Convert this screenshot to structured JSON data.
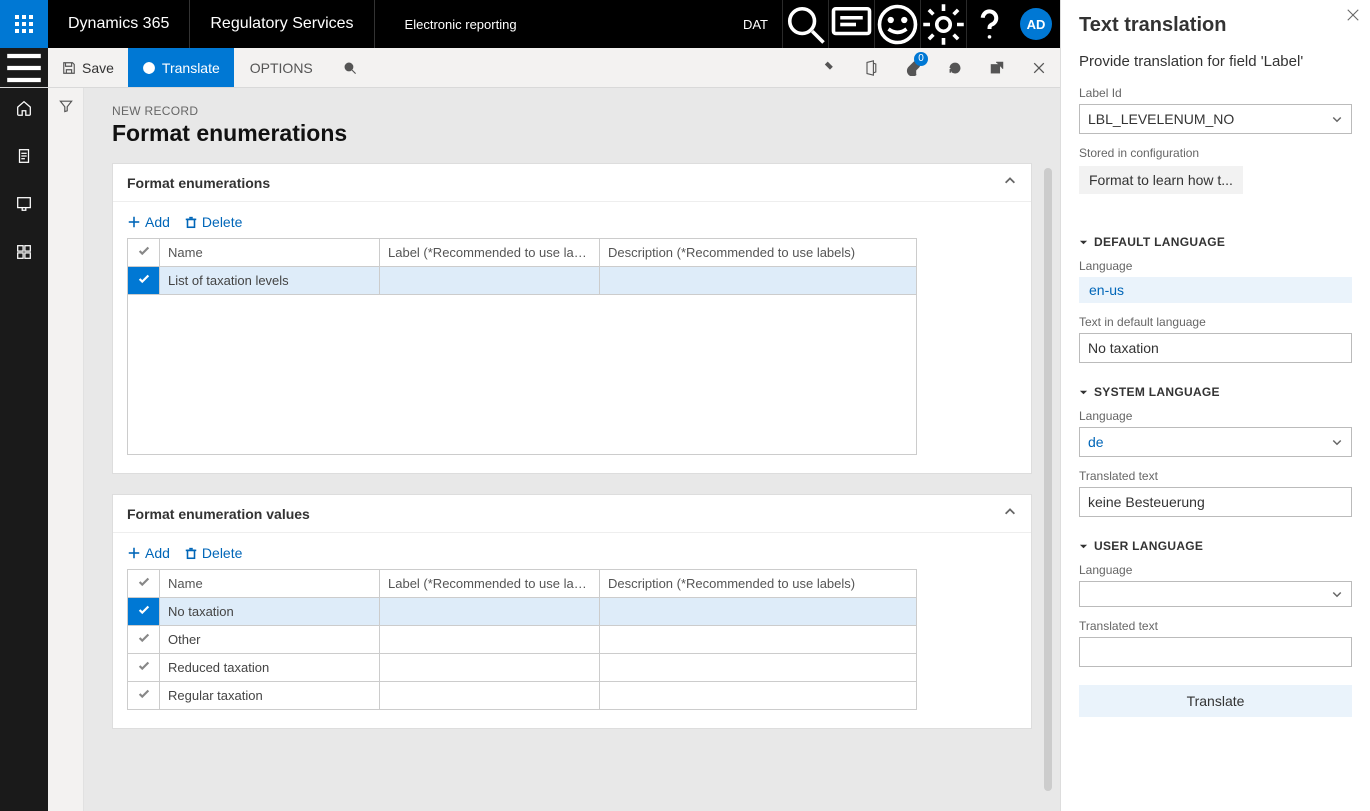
{
  "topbar": {
    "brand": "Dynamics 365",
    "service": "Regulatory Services",
    "breadcrumb": "Electronic reporting",
    "entity": "DAT",
    "avatar": "AD"
  },
  "actionbar": {
    "save": "Save",
    "translate": "Translate",
    "options": "OPTIONS",
    "badge": "0"
  },
  "page": {
    "newRecord": "NEW RECORD",
    "title": "Format enumerations"
  },
  "card1": {
    "title": "Format enumerations",
    "add": "Add",
    "delete": "Delete",
    "columns": {
      "name": "Name",
      "label": "Label (*Recommended to use labels)",
      "description": "Description (*Recommended to use labels)"
    },
    "rows": [
      {
        "name": "List of taxation levels",
        "label": "",
        "description": "",
        "selected": true
      }
    ]
  },
  "card2": {
    "title": "Format enumeration values",
    "add": "Add",
    "delete": "Delete",
    "columns": {
      "name": "Name",
      "label": "Label (*Recommended to use labels)",
      "description": "Description (*Recommended to use labels)"
    },
    "rows": [
      {
        "name": "No taxation",
        "label": "",
        "description": "",
        "selected": true
      },
      {
        "name": "Other",
        "label": "",
        "description": "",
        "selected": false
      },
      {
        "name": "Reduced taxation",
        "label": "",
        "description": "",
        "selected": false
      },
      {
        "name": "Regular taxation",
        "label": "",
        "description": "",
        "selected": false
      }
    ]
  },
  "panel": {
    "title": "Text translation",
    "subtitle": "Provide translation for field 'Label'",
    "labelIdField": "Label Id",
    "labelId": "LBL_LEVELENUM_NO",
    "storedInField": "Stored in configuration",
    "storedIn": "Format to learn how t...",
    "sections": {
      "default": {
        "header": "DEFAULT LANGUAGE",
        "languageLabel": "Language",
        "language": "en-us",
        "textLabel": "Text in default language",
        "text": "No taxation"
      },
      "system": {
        "header": "SYSTEM LANGUAGE",
        "languageLabel": "Language",
        "language": "de",
        "textLabel": "Translated text",
        "text": "keine Besteuerung"
      },
      "user": {
        "header": "USER LANGUAGE",
        "languageLabel": "Language",
        "language": "",
        "textLabel": "Translated text",
        "text": ""
      }
    },
    "translateBtn": "Translate"
  }
}
